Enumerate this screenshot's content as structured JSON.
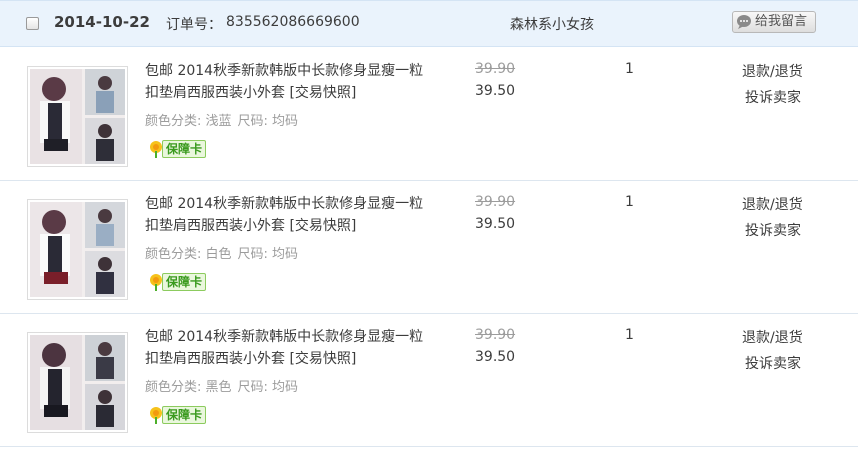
{
  "order": {
    "date": "2014-10-22",
    "order_no_label": "订单号：",
    "order_no": "835562086669600",
    "seller": "森林系小女孩",
    "message_button": "给我留言"
  },
  "items": [
    {
      "title": "包邮 2014秋季新款韩版中长款修身显瘦一粒扣垫肩西服西装小外套 [交易快照]",
      "sku_color": "颜色分类: 浅蓝",
      "sku_size": "尺码: 均码",
      "guarantee": "保障卡",
      "original_price": "39.90",
      "price": "39.50",
      "quantity": "1",
      "refund_link": "退款/退货",
      "complain_link": "投诉卖家"
    },
    {
      "title": "包邮 2014秋季新款韩版中长款修身显瘦一粒扣垫肩西服西装小外套 [交易快照]",
      "sku_color": "颜色分类: 白色",
      "sku_size": "尺码: 均码",
      "guarantee": "保障卡",
      "original_price": "39.90",
      "price": "39.50",
      "quantity": "1",
      "refund_link": "退款/退货",
      "complain_link": "投诉卖家"
    },
    {
      "title": "包邮 2014秋季新款韩版中长款修身显瘦一粒扣垫肩西服西装小外套 [交易快照]",
      "sku_color": "颜色分类: 黑色",
      "sku_size": "尺码: 均码",
      "guarantee": "保障卡",
      "original_price": "39.90",
      "price": "39.50",
      "quantity": "1",
      "refund_link": "退款/退货",
      "complain_link": "投诉卖家"
    }
  ],
  "colors": {
    "header_bg": "#eaf3fc",
    "text": "#3c3c3c",
    "muted": "#9c9c9c",
    "guarantee_green": "#3a9a1e"
  }
}
